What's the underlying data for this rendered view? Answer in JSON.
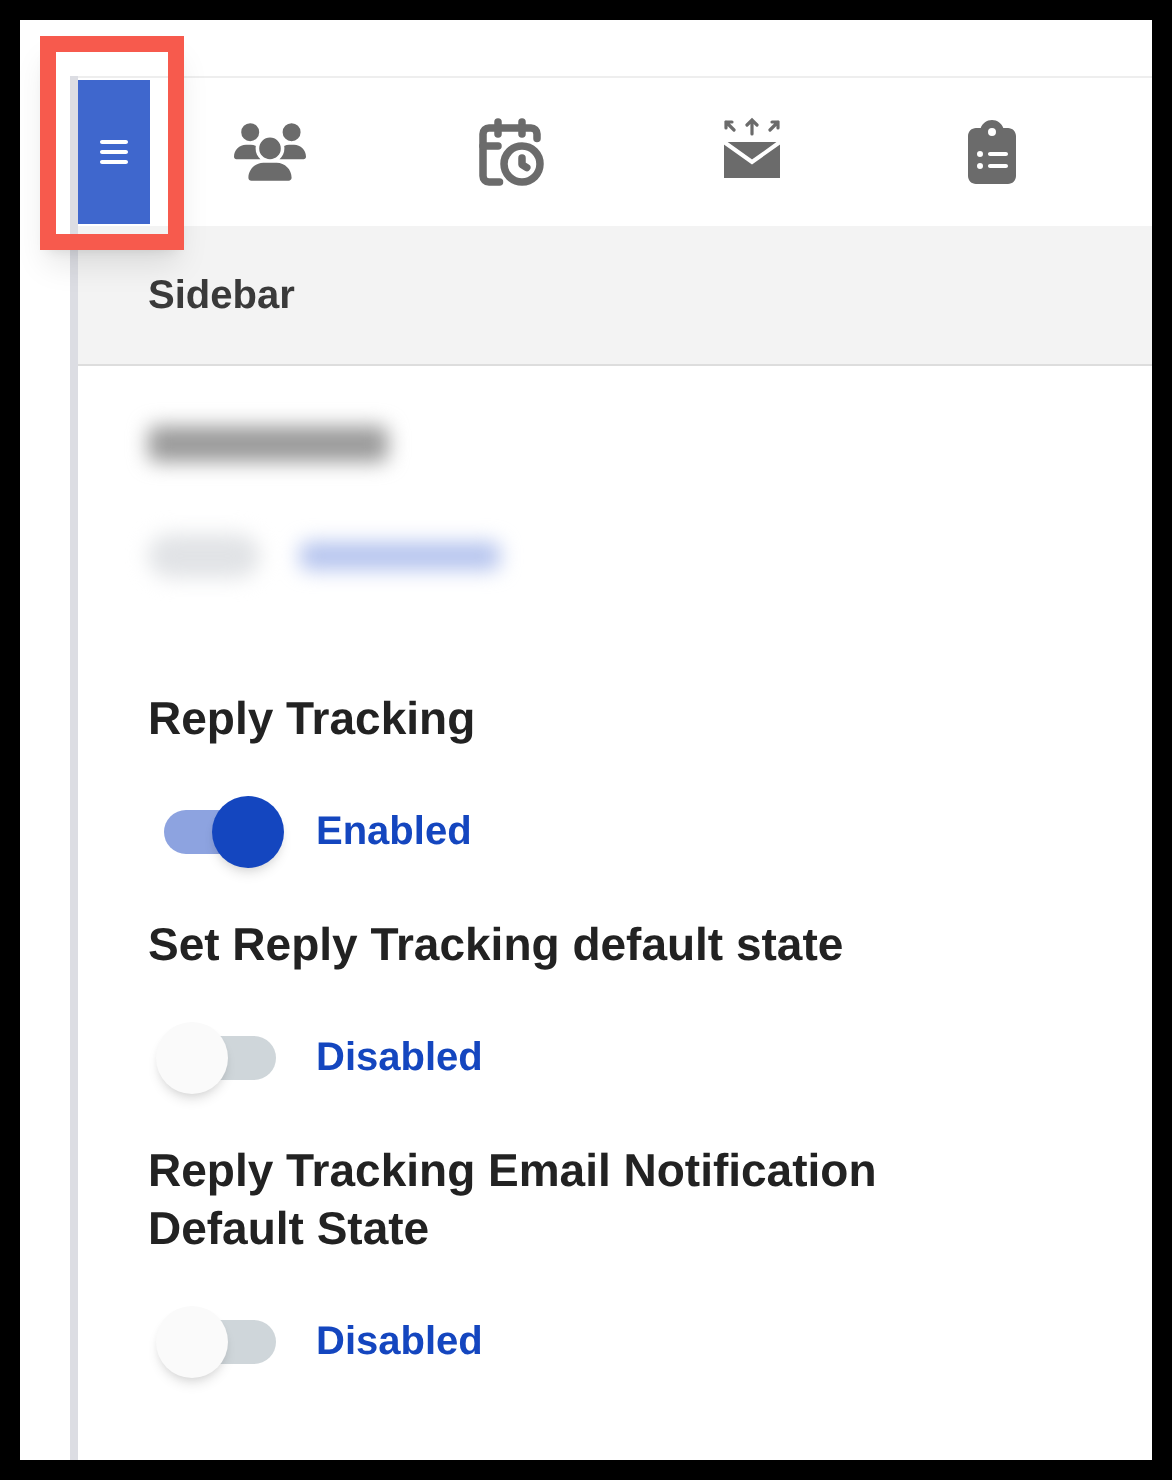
{
  "toolbar": {
    "items": [
      {
        "kind": "menu",
        "selected": true
      },
      {
        "kind": "users",
        "selected": false
      },
      {
        "kind": "calendar",
        "selected": false
      },
      {
        "kind": "mail",
        "selected": false
      },
      {
        "kind": "clipboard",
        "selected": false
      }
    ]
  },
  "panel": {
    "title": "Sidebar"
  },
  "settings": [
    {
      "label": "Reply Tracking",
      "on": true,
      "status": "Enabled"
    },
    {
      "label": "Set Reply Tracking default state",
      "on": false,
      "status": "Disabled"
    },
    {
      "label": "Reply Tracking Email Notification Default State",
      "on": false,
      "status": "Disabled"
    }
  ]
}
